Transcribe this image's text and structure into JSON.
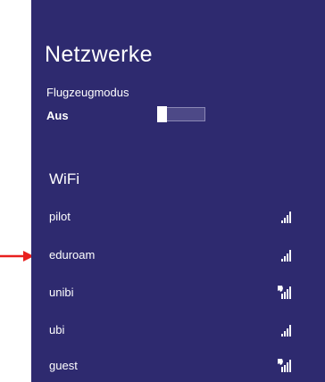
{
  "panel": {
    "title": "Netzwerke",
    "background_color": "#2e2a6f"
  },
  "airplane_mode": {
    "label": "Flugzeugmodus",
    "value": "Aus",
    "on": false
  },
  "wifi": {
    "header": "WiFi",
    "networks": [
      {
        "name": "pilot",
        "secured": false,
        "icon": "wifi-signal-icon"
      },
      {
        "name": "eduroam",
        "secured": false,
        "icon": "wifi-signal-icon"
      },
      {
        "name": "unibi",
        "secured": true,
        "icon": "wifi-secured-signal-icon"
      },
      {
        "name": "ubi",
        "secured": false,
        "icon": "wifi-signal-icon"
      },
      {
        "name": "guest",
        "secured": true,
        "icon": "wifi-secured-signal-icon"
      }
    ]
  },
  "annotation": {
    "arrow_color": "#e8201e",
    "points_to": "eduroam"
  }
}
